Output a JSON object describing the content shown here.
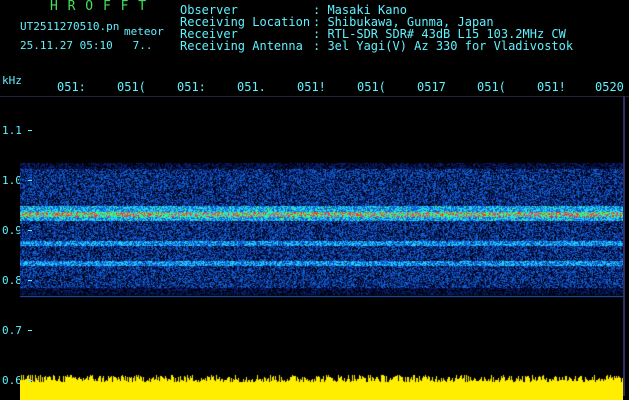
{
  "app": {
    "name": "H R O F F T"
  },
  "file": {
    "name": "UT2511270510.pn",
    "suffix": "meteor",
    "timestamp": "25.11.27 05:10",
    "extra": "7.."
  },
  "header": [
    {
      "key": "Observer",
      "value": ": Masaki Kano"
    },
    {
      "key": "Receiving Location",
      "value": ": Shibukawa, Gunma, Japan"
    },
    {
      "key": "Receiver",
      "value": ": RTL-SDR SDR# 43dB L15 103.2MHz CW"
    },
    {
      "key": "Receiving Antenna",
      "value": ": 3el Yagi(V) Az 330 for Vladivostok"
    }
  ],
  "axis": {
    "y_unit": "kHz",
    "y_ticks": [
      "1.1",
      "1.0",
      "0.9",
      "0.8",
      "0.7",
      "0.6"
    ],
    "x_ticks": [
      "051:",
      "051(",
      "051:",
      "051.",
      "051!",
      "051(",
      "0517",
      "051(",
      "051!",
      "0520"
    ]
  },
  "colors": {
    "label": "#5ff2ff",
    "title": "#3fe25a",
    "amplitude": "#ffee00"
  }
}
